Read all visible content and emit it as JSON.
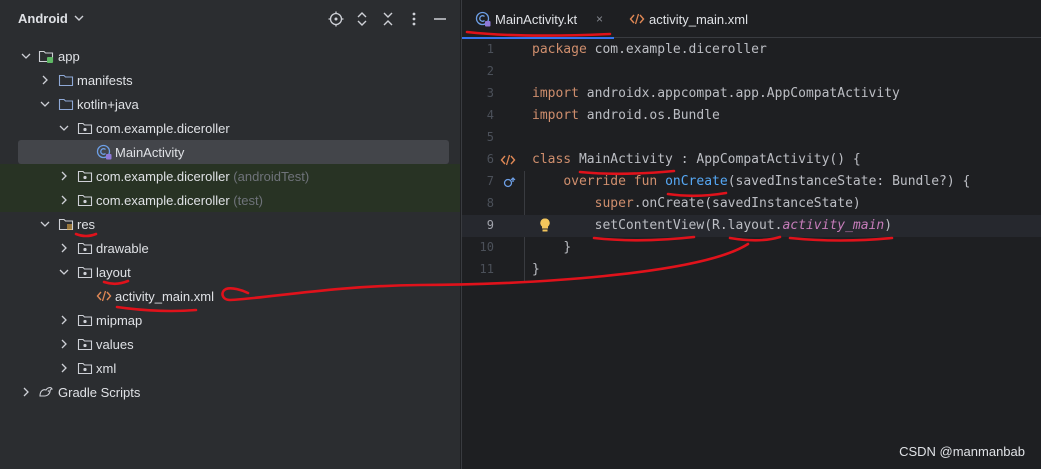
{
  "project_panel": {
    "title": "Android",
    "tree": [
      {
        "id": "app",
        "label": "app",
        "suffix": "",
        "icon": "module-folder-icon",
        "arrow": "expanded"
      },
      {
        "id": "manifests",
        "label": "manifests",
        "suffix": "",
        "icon": "folder-icon",
        "arrow": "collapsed"
      },
      {
        "id": "kotlin-java",
        "label": "kotlin+java",
        "suffix": "",
        "icon": "folder-icon",
        "arrow": "expanded"
      },
      {
        "id": "pkg-main",
        "label": "com.example.diceroller",
        "suffix": "",
        "icon": "package-icon",
        "arrow": "expanded"
      },
      {
        "id": "main-activity",
        "label": "MainActivity",
        "suffix": "",
        "icon": "kotlin-class-icon",
        "arrow": "none"
      },
      {
        "id": "pkg-android-test",
        "label": "com.example.diceroller",
        "suffix": "(androidTest)",
        "icon": "package-icon",
        "arrow": "collapsed"
      },
      {
        "id": "pkg-test",
        "label": "com.example.diceroller",
        "suffix": "(test)",
        "icon": "package-icon",
        "arrow": "collapsed"
      },
      {
        "id": "res",
        "label": "res",
        "suffix": "",
        "icon": "resource-folder-icon",
        "arrow": "expanded"
      },
      {
        "id": "drawable",
        "label": "drawable",
        "suffix": "",
        "icon": "package-icon",
        "arrow": "collapsed"
      },
      {
        "id": "layout",
        "label": "layout",
        "suffix": "",
        "icon": "package-icon",
        "arrow": "expanded"
      },
      {
        "id": "activity-main-xml",
        "label": "activity_main.xml",
        "suffix": "",
        "icon": "xml-file-icon",
        "arrow": "none"
      },
      {
        "id": "mipmap",
        "label": "mipmap",
        "suffix": "",
        "icon": "package-icon",
        "arrow": "collapsed"
      },
      {
        "id": "values",
        "label": "values",
        "suffix": "",
        "icon": "package-icon",
        "arrow": "collapsed"
      },
      {
        "id": "xml",
        "label": "xml",
        "suffix": "",
        "icon": "package-icon",
        "arrow": "collapsed"
      },
      {
        "id": "gradle-scripts",
        "label": "Gradle Scripts",
        "suffix": "",
        "icon": "gradle-icon",
        "arrow": "collapsed"
      }
    ]
  },
  "editor": {
    "tabs": [
      {
        "label": "MainActivity.kt",
        "icon": "kotlin-class-icon",
        "active": true,
        "close": "×"
      },
      {
        "label": "activity_main.xml",
        "icon": "xml-file-icon",
        "active": false
      }
    ],
    "lines": [
      {
        "n": "1",
        "text": "package com.example.diceroller"
      },
      {
        "n": "2",
        "text": ""
      },
      {
        "n": "3",
        "text": "import androidx.appcompat.app.AppCompatActivity"
      },
      {
        "n": "4",
        "text": "import android.os.Bundle"
      },
      {
        "n": "5",
        "text": ""
      },
      {
        "n": "6",
        "text": "class MainActivity : AppCompatActivity() {"
      },
      {
        "n": "7",
        "text": "    override fun onCreate(savedInstanceState: Bundle?) {"
      },
      {
        "n": "8",
        "text": "        super.onCreate(savedInstanceState)"
      },
      {
        "n": "9",
        "text": "        setContentView(R.layout.activity_main)"
      },
      {
        "n": "10",
        "text": "    }"
      },
      {
        "n": "11",
        "text": "}"
      }
    ],
    "tokens": {
      "package_kw": "package",
      "package_name": " com.example.diceroller",
      "import_kw": "import",
      "import1": " androidx.appcompat.app.AppCompatActivity",
      "import2": " android.os.Bundle",
      "class_kw": "class",
      "class_name": "MainActivity",
      "class_rest": " : AppCompatActivity() {",
      "override_kw": "override",
      "fun_kw": "fun",
      "fn_name": "onCreate",
      "fn_params": "(savedInstanceState: Bundle?) {",
      "super_kw": "super",
      "super_rest": ".onCreate(savedInstanceState)",
      "set_cv": "setContentView",
      "r_layout": "(R.layout.",
      "activity_main": "activity_main",
      "close_paren": ")",
      "close_brace_inner": "}",
      "close_brace_outer": "}"
    }
  },
  "watermark": "CSDN @manmanbab",
  "colors": {
    "accent": "#3574f0",
    "annotation": "#e0121b",
    "keyword": "#cf8e6d",
    "function": "#56a8f5"
  }
}
